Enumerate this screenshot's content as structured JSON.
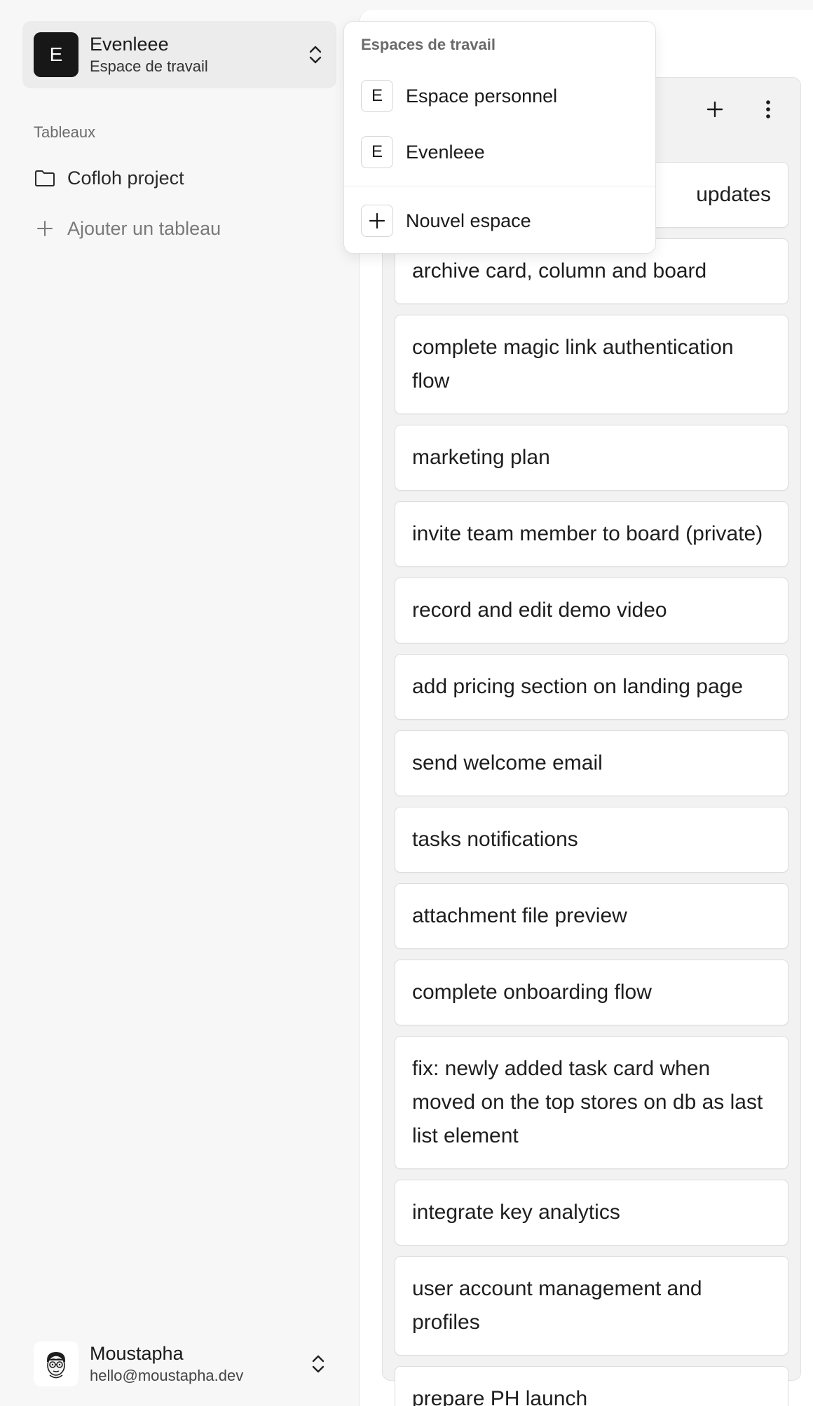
{
  "workspace": {
    "avatar_letter": "E",
    "name": "Evenleee",
    "subtitle": "Espace de travail"
  },
  "sidebar": {
    "section_label": "Tableaux",
    "boards": [
      {
        "label": "Cofloh project",
        "icon": "folder-icon"
      }
    ],
    "add_board_label": "Ajouter un tableau"
  },
  "user": {
    "name": "Moustapha",
    "email": "hello@moustapha.dev"
  },
  "dropdown": {
    "title": "Espaces de travail",
    "items": [
      {
        "badge": "E",
        "label": "Espace personnel"
      },
      {
        "badge": "E",
        "label": "Evenleee"
      }
    ],
    "new_label": "Nouvel espace"
  },
  "column": {
    "cards": [
      "updates",
      "archive card, column and board",
      "complete magic link authentication flow",
      "marketing plan",
      "invite team member to board (private)",
      "record and edit demo video",
      "add pricing section on landing page",
      "send welcome email",
      "tasks notifications",
      "attachment file preview",
      "complete onboarding flow",
      "fix: newly added task card when moved on the top stores on db as last list element",
      "integrate key analytics",
      "user account management and profiles",
      "prepare PH launch"
    ]
  }
}
